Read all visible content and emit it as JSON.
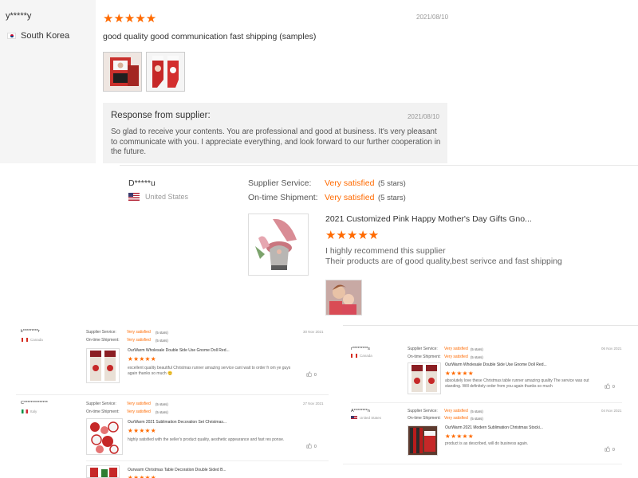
{
  "panel_a": {
    "reviewer_name": "y*****y",
    "country": "South Korea",
    "stars": "★★★★★",
    "date": "2021/08/10",
    "review_text": "good quality good communication fast shipping (samples)",
    "response": {
      "title": "Response from supplier:",
      "date": "2021/08/10",
      "text": "So glad to receive your contents. You are professional and good at business. It's very pleasant to communicate with you. I appreciate everything, and look forward to our further cooperation in the future."
    }
  },
  "panel_b": {
    "reviewer_name": "D*****u",
    "country": "United States",
    "supplier_service_label": "Supplier Service:",
    "supplier_service_value": "Very satisfied",
    "supplier_service_stars": "(5 stars)",
    "ontime_label": "On-time Shipment:",
    "ontime_value": "Very satisfied",
    "ontime_stars": "(5 stars)",
    "product_title": "2021 Customized Pink Happy Mother's Day Gifts Gno...",
    "stars": "★★★★★",
    "text_line1": "I highly recommend this supplier",
    "text_line2": "Their products are of good quality,best serivce and fast shipping"
  },
  "panel_c": {
    "reviews": [
      {
        "name": "k*********r",
        "country": "Canada",
        "date": "30 Nov 2021",
        "supplier_service_label": "Supplier Service:",
        "supplier_service_value": "Very satisfied",
        "supplier_service_stars": "(5 stars)",
        "ontime_label": "On-time Shipment:",
        "ontime_value": "Very satisfied",
        "ontime_stars": "(5 stars)",
        "product_title": "OurWarm Wholesale Double Side Use Gnome Doll Red...",
        "stars": "★★★★★",
        "text": "excellent quality beautiful Christmas runner amazing service cant wait to order fr om ye guys again thanks so much 😊",
        "likes": "0"
      },
      {
        "name": "C**************",
        "country": "Italy",
        "date": "27 Nov 2021",
        "supplier_service_label": "Supplier Service:",
        "supplier_service_value": "Very satisfied",
        "supplier_service_stars": "(5 stars)",
        "ontime_label": "On-time Shipment:",
        "ontime_value": "Very satisfied",
        "ontime_stars": "(5 stars)",
        "product_title": "OurWarm 2021 Sublimation Decoration Set Christmas...",
        "stars": "★★★★★",
        "text": "highly satisfied with the seller's product quality, aesthetic appearance and fast res ponse.",
        "likes": "0"
      },
      {
        "product_title": "Ourwarm Christmas Table Decoration Double Sided B...",
        "stars": "★★★★★"
      }
    ]
  },
  "panel_d": {
    "reviews": [
      {
        "name": "r*********s",
        "country": "Canada",
        "date": "06 Nov 2021",
        "supplier_service_label": "Supplier Service:",
        "supplier_service_value": "Very satisfied",
        "supplier_service_stars": "(5 stars)",
        "ontime_label": "On-time Shipment:",
        "ontime_value": "Very satisfied",
        "ontime_stars": "(5 stars)",
        "product_title": "OurWarm Wholesale Double Side Use Gnome Doll Red...",
        "stars": "★★★★★",
        "text": "absolutely love these Christmas table runner amazing quality The service was out standing. Will definitely order from you again thanks so much",
        "likes": "0"
      },
      {
        "name": "A********n",
        "country": "United States",
        "date": "04 Nov 2021",
        "supplier_service_label": "Supplier Service:",
        "supplier_service_value": "Very satisfied",
        "supplier_service_stars": "(5 stars)",
        "ontime_label": "On-time Shipment:",
        "ontime_value": "Very satisfied",
        "ontime_stars": "(5 stars)",
        "product_title": "OurWarm 2021 Modern Sublimation Christmas Stocki...",
        "stars": "★★★★★",
        "text": "product is as described, will do business again.",
        "likes": "0"
      }
    ]
  },
  "icons": {
    "thumbs_up": "thumbs-up-icon",
    "star": "star-icon"
  },
  "colors": {
    "accent": "#ff6a00",
    "response_bg": "#f2f2f2",
    "sidebar_bg": "#f5f5f5"
  }
}
